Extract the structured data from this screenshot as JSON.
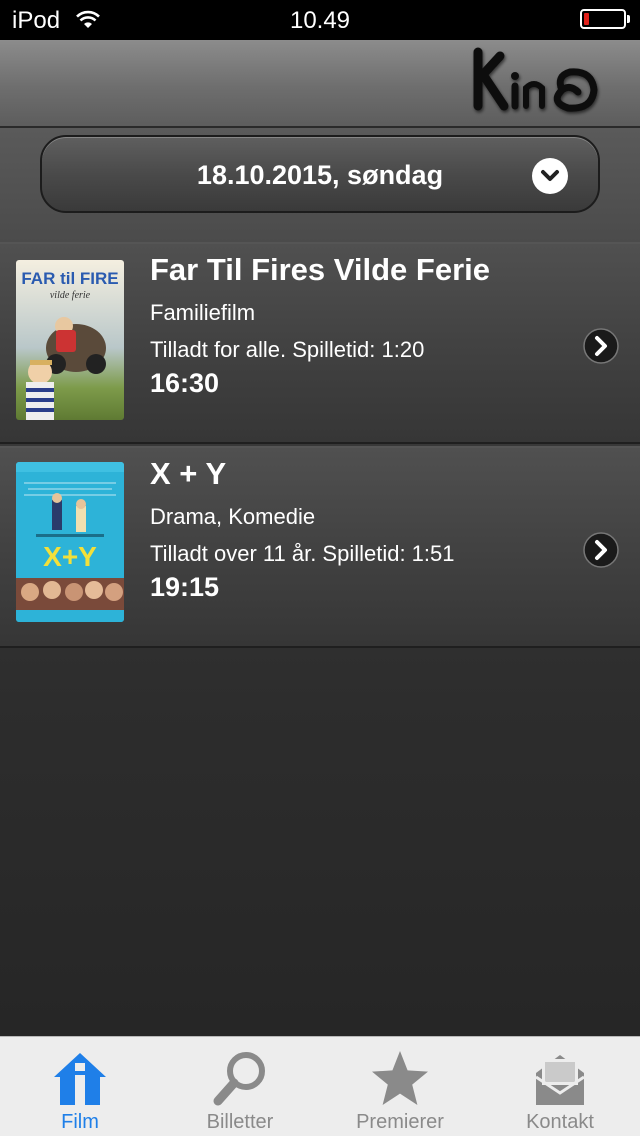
{
  "status_bar": {
    "carrier": "iPod",
    "time": "10.49",
    "battery_level": 0.12,
    "battery_color": "#e0201a"
  },
  "header": {
    "logo_text": "Kino"
  },
  "date_picker": {
    "value": "18.10.2015, søndag",
    "icon": "chevron-down-icon"
  },
  "movies": [
    {
      "title": "Far Til Fires Vilde Ferie",
      "genre": "Familiefilm",
      "info": "Tilladt for alle. Spilletid: 1:20",
      "time": "16:30",
      "poster_title": "FAR til FIRE",
      "poster_subtitle": "vilde ferie"
    },
    {
      "title": "X + Y",
      "genre": "Drama, Komedie",
      "info": "Tilladt over 11 år. Spilletid: 1:51",
      "time": "19:15",
      "poster_title": "X+Y"
    }
  ],
  "tab_bar": {
    "active_color": "#1f7fe8",
    "inactive_color": "#8a8a8a",
    "tabs": [
      {
        "label": "Film",
        "icon": "house-icon",
        "active": true
      },
      {
        "label": "Billetter",
        "icon": "search-icon",
        "active": false
      },
      {
        "label": "Premierer",
        "icon": "star-icon",
        "active": false
      },
      {
        "label": "Kontakt",
        "icon": "envelope-icon",
        "active": false
      }
    ]
  }
}
